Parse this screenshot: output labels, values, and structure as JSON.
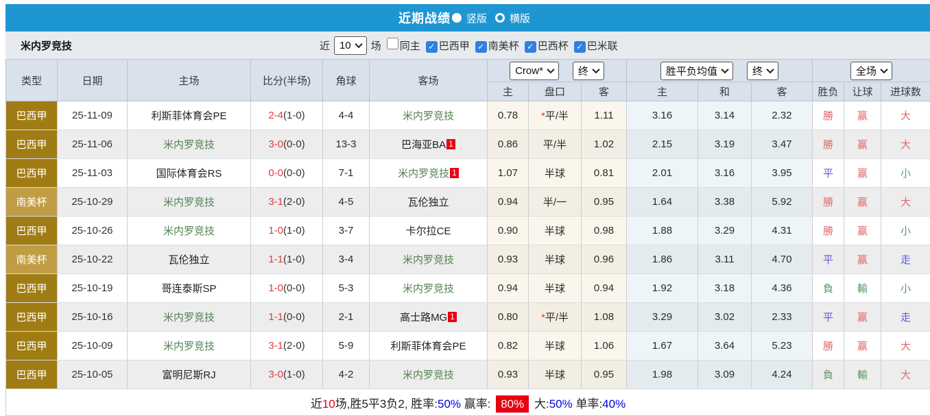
{
  "titlebar": {
    "title": "近期战绩",
    "layout_options": [
      {
        "label": "竖版",
        "selected": true
      },
      {
        "label": "横版",
        "selected": false
      }
    ]
  },
  "filterbar": {
    "team": "米内罗竞技",
    "recent_label": "近",
    "count": "10",
    "games_label": "场",
    "checkboxes": [
      {
        "label": "同主",
        "checked": false
      },
      {
        "label": "巴西甲",
        "checked": true
      },
      {
        "label": "南美杯",
        "checked": true
      },
      {
        "label": "巴西杯",
        "checked": true
      },
      {
        "label": "巴米联",
        "checked": true
      }
    ]
  },
  "table": {
    "selects": {
      "bookmaker": "Crow*",
      "bookmaker_final": "终",
      "average": "胜平负均值",
      "average_final": "终",
      "scope": "全场"
    },
    "columns_left": [
      "类型",
      "日期",
      "主场",
      "比分(半场)",
      "角球",
      "客场"
    ],
    "columns_sub": [
      "主",
      "盘口",
      "客",
      "主",
      "和",
      "客",
      "胜负",
      "让球",
      "进球数"
    ],
    "rows": [
      {
        "type": "巴西甲",
        "shade": "dark",
        "date": "25-11-09",
        "home": {
          "name": "利斯菲体育会PE",
          "focus": false
        },
        "score": "2-4",
        "half": "(1-0)",
        "corners": "4-4",
        "away": {
          "name": "米内罗竞技",
          "focus": true
        },
        "odds": [
          "0.78",
          "*平/半",
          "1.11"
        ],
        "avg": [
          "3.16",
          "3.14",
          "2.32"
        ],
        "results": [
          {
            "text": "勝",
            "color": "red"
          },
          {
            "text": "赢",
            "color": "red"
          },
          {
            "text": "大",
            "color": "red"
          }
        ]
      },
      {
        "type": "巴西甲",
        "shade": "dark",
        "date": "25-11-06",
        "home": {
          "name": "米内罗竞技",
          "focus": true
        },
        "score": "3-0",
        "half": "(0-0)",
        "corners": "13-3",
        "away": {
          "name": "巴海亚BA",
          "focus": false,
          "badge": "1"
        },
        "odds": [
          "0.86",
          "平/半",
          "1.02"
        ],
        "avg": [
          "2.15",
          "3.19",
          "3.47"
        ],
        "results": [
          {
            "text": "勝",
            "color": "red"
          },
          {
            "text": "赢",
            "color": "red"
          },
          {
            "text": "大",
            "color": "red"
          }
        ]
      },
      {
        "type": "巴西甲",
        "shade": "dark",
        "date": "25-11-03",
        "home": {
          "name": "国际体育会RS",
          "focus": false
        },
        "score": "0-0",
        "half": "(0-0)",
        "corners": "7-1",
        "away": {
          "name": "米内罗竞技",
          "focus": true,
          "badge": "1"
        },
        "odds": [
          "1.07",
          "半球",
          "0.81"
        ],
        "avg": [
          "2.01",
          "3.16",
          "3.95"
        ],
        "results": [
          {
            "text": "平",
            "color": "blue"
          },
          {
            "text": "赢",
            "color": "red"
          },
          {
            "text": "小",
            "color": "green"
          }
        ]
      },
      {
        "type": "南美杯",
        "shade": "light",
        "date": "25-10-29",
        "home": {
          "name": "米内罗竞技",
          "focus": true
        },
        "score": "3-1",
        "half": "(2-0)",
        "corners": "4-5",
        "away": {
          "name": "瓦伦独立",
          "focus": false
        },
        "odds": [
          "0.94",
          "半/一",
          "0.95"
        ],
        "avg": [
          "1.64",
          "3.38",
          "5.92"
        ],
        "results": [
          {
            "text": "勝",
            "color": "red"
          },
          {
            "text": "赢",
            "color": "red"
          },
          {
            "text": "大",
            "color": "red"
          }
        ]
      },
      {
        "type": "巴西甲",
        "shade": "dark",
        "date": "25-10-26",
        "home": {
          "name": "米内罗竞技",
          "focus": true
        },
        "score": "1-0",
        "half": "(1-0)",
        "corners": "3-7",
        "away": {
          "name": "卡尔拉CE",
          "focus": false
        },
        "odds": [
          "0.90",
          "半球",
          "0.98"
        ],
        "avg": [
          "1.88",
          "3.29",
          "4.31"
        ],
        "results": [
          {
            "text": "勝",
            "color": "red"
          },
          {
            "text": "赢",
            "color": "red"
          },
          {
            "text": "小",
            "color": "green"
          }
        ]
      },
      {
        "type": "南美杯",
        "shade": "light",
        "date": "25-10-22",
        "home": {
          "name": "瓦伦独立",
          "focus": false
        },
        "score": "1-1",
        "half": "(1-0)",
        "corners": "3-4",
        "away": {
          "name": "米内罗竞技",
          "focus": true
        },
        "odds": [
          "0.93",
          "半球",
          "0.96"
        ],
        "avg": [
          "1.86",
          "3.11",
          "4.70"
        ],
        "results": [
          {
            "text": "平",
            "color": "blue"
          },
          {
            "text": "赢",
            "color": "red"
          },
          {
            "text": "走",
            "color": "blue"
          }
        ]
      },
      {
        "type": "巴西甲",
        "shade": "dark",
        "date": "25-10-19",
        "home": {
          "name": "哥连泰斯SP",
          "focus": false
        },
        "score": "1-0",
        "half": "(0-0)",
        "corners": "5-3",
        "away": {
          "name": "米内罗竞技",
          "focus": true
        },
        "odds": [
          "0.94",
          "半球",
          "0.94"
        ],
        "avg": [
          "1.92",
          "3.18",
          "4.36"
        ],
        "results": [
          {
            "text": "負",
            "color": "green"
          },
          {
            "text": "輸",
            "color": "green"
          },
          {
            "text": "小",
            "color": "green"
          }
        ]
      },
      {
        "type": "巴西甲",
        "shade": "dark",
        "date": "25-10-16",
        "home": {
          "name": "米内罗竞技",
          "focus": true
        },
        "score": "1-1",
        "half": "(0-0)",
        "corners": "2-1",
        "away": {
          "name": "高士路MG",
          "focus": false,
          "badge": "1"
        },
        "odds": [
          "0.80",
          "*平/半",
          "1.08"
        ],
        "avg": [
          "3.29",
          "3.02",
          "2.33"
        ],
        "results": [
          {
            "text": "平",
            "color": "blue"
          },
          {
            "text": "赢",
            "color": "red"
          },
          {
            "text": "走",
            "color": "blue"
          }
        ]
      },
      {
        "type": "巴西甲",
        "shade": "dark",
        "date": "25-10-09",
        "home": {
          "name": "米内罗竞技",
          "focus": true
        },
        "score": "3-1",
        "half": "(2-0)",
        "corners": "5-9",
        "away": {
          "name": "利斯菲体育会PE",
          "focus": false
        },
        "odds": [
          "0.82",
          "半球",
          "1.06"
        ],
        "avg": [
          "1.67",
          "3.64",
          "5.23"
        ],
        "results": [
          {
            "text": "勝",
            "color": "red"
          },
          {
            "text": "赢",
            "color": "red"
          },
          {
            "text": "大",
            "color": "red"
          }
        ]
      },
      {
        "type": "巴西甲",
        "shade": "dark",
        "date": "25-10-05",
        "home": {
          "name": "富明尼斯RJ",
          "focus": false
        },
        "score": "3-0",
        "half": "(1-0)",
        "corners": "4-2",
        "away": {
          "name": "米内罗竞技",
          "focus": true
        },
        "odds": [
          "0.93",
          "半球",
          "0.95"
        ],
        "avg": [
          "1.98",
          "3.09",
          "4.24"
        ],
        "results": [
          {
            "text": "負",
            "color": "green"
          },
          {
            "text": "輸",
            "color": "green"
          },
          {
            "text": "大",
            "color": "red"
          }
        ]
      }
    ]
  },
  "summary": {
    "segments": [
      {
        "text": "近",
        "style": "plain"
      },
      {
        "text": "10",
        "style": "red"
      },
      {
        "text": "场,胜5平3负2, 胜率:",
        "style": "plain"
      },
      {
        "text": "50%",
        "style": "blue"
      },
      {
        "text": " 赢率: ",
        "style": "plain"
      },
      {
        "text": "80%",
        "style": "badge"
      },
      {
        "text": " 大:",
        "style": "plain"
      },
      {
        "text": "50%",
        "style": "blue"
      },
      {
        "text": " 单率:",
        "style": "plain"
      },
      {
        "text": "40%",
        "style": "blue"
      }
    ]
  },
  "colors": {
    "accent_blue": "#1e96d2",
    "league_gold_dark": "#a07c14",
    "league_gold_light": "#c09d45",
    "focus_team_green": "#548254",
    "score_red": "#e43b3b",
    "result_win_red": "#e26868",
    "result_draw_blue": "#5b5bdc",
    "result_loss_green": "#5f9762",
    "badge_red": "#e60012",
    "summary_blue": "#0000e6",
    "checkbox_blue": "#2f80e0"
  }
}
